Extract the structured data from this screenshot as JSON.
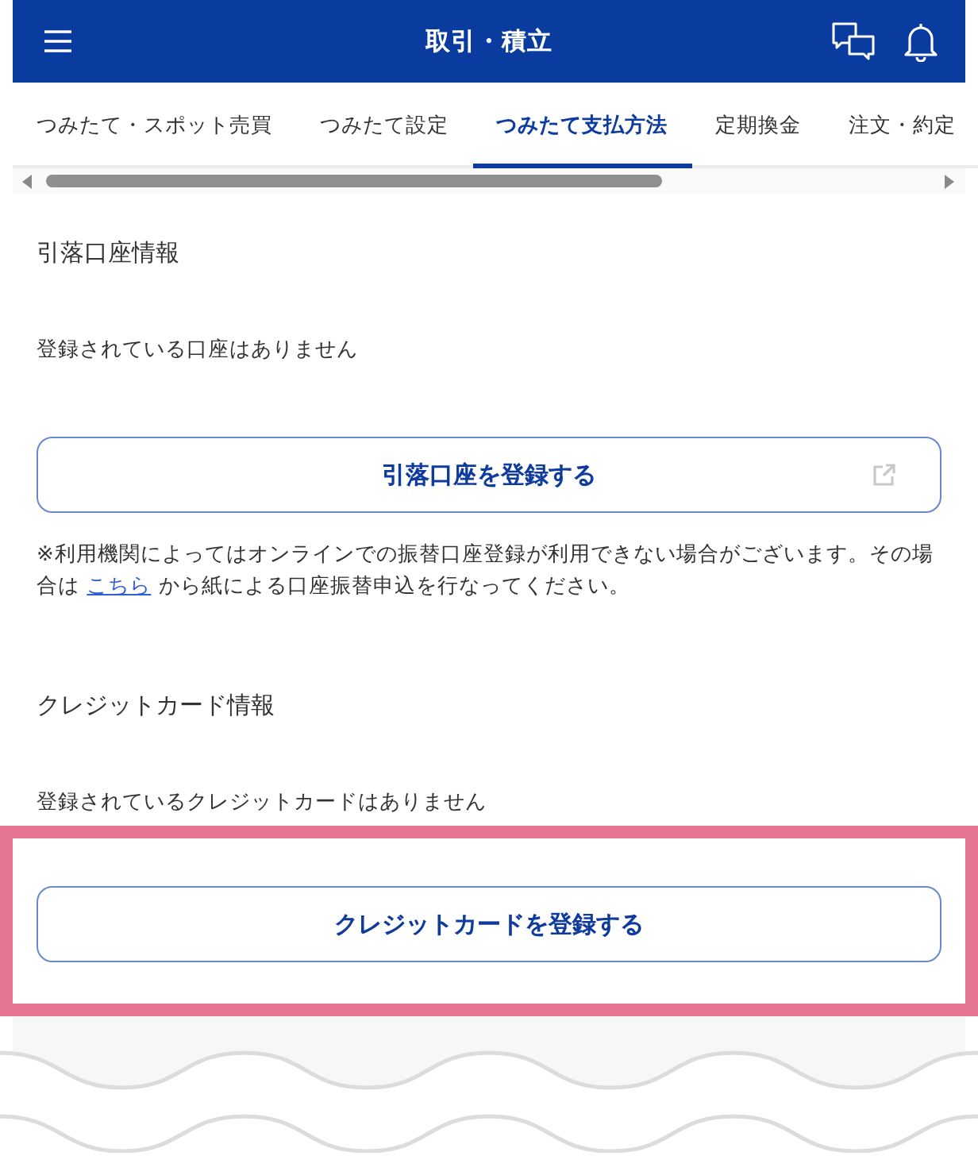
{
  "header": {
    "title": "取引・積立"
  },
  "tabs": [
    {
      "label": "つみたて・スポット売買",
      "selected": false
    },
    {
      "label": "つみたて設定",
      "selected": false
    },
    {
      "label": "つみたて支払方法",
      "selected": true
    },
    {
      "label": "定期換金",
      "selected": false
    },
    {
      "label": "注文・約定",
      "selected": false
    }
  ],
  "sections": [
    {
      "heading": "引落口座情報",
      "status": "登録されている口座はありません",
      "button": {
        "label": "引落口座を登録する",
        "external": true,
        "highlighted": false
      },
      "note": {
        "before": "※利用機関によってはオンラインでの振替口座登録が利用できない場合がございます。その場合は ",
        "link": "こちら",
        "after": " から紙による口座振替申込を行なってください。"
      }
    },
    {
      "heading": "クレジットカード情報",
      "status": "登録されているクレジットカードはありません",
      "button": {
        "label": "クレジットカードを登録する",
        "external": false,
        "highlighted": true
      }
    }
  ]
}
